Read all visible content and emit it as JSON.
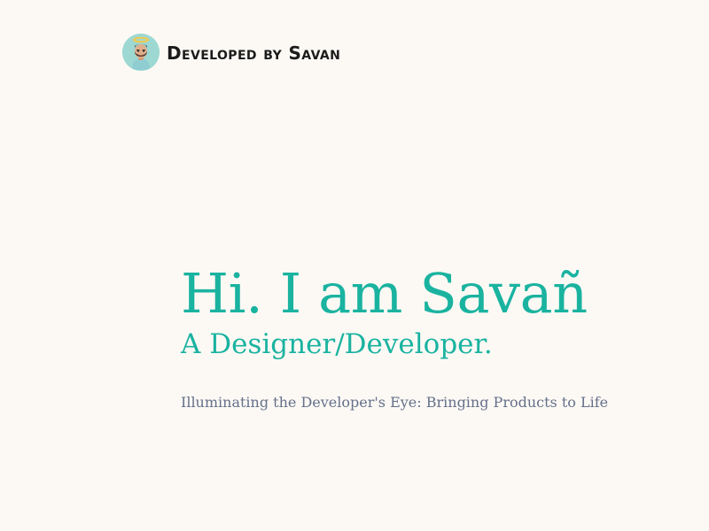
{
  "header": {
    "logo_text": "Developed by Savan",
    "avatar_icon": "avatar-icon"
  },
  "hero": {
    "title": "Hi. I am Savañ",
    "subtitle": "A Designer/Developer.",
    "tagline": "Illuminating the Developer's Eye: Bringing Products to Life"
  },
  "colors": {
    "background": "#fcf9f5",
    "accent": "#1ab3a0",
    "tagline": "#657089",
    "brand_text": "#1b1b1b"
  }
}
